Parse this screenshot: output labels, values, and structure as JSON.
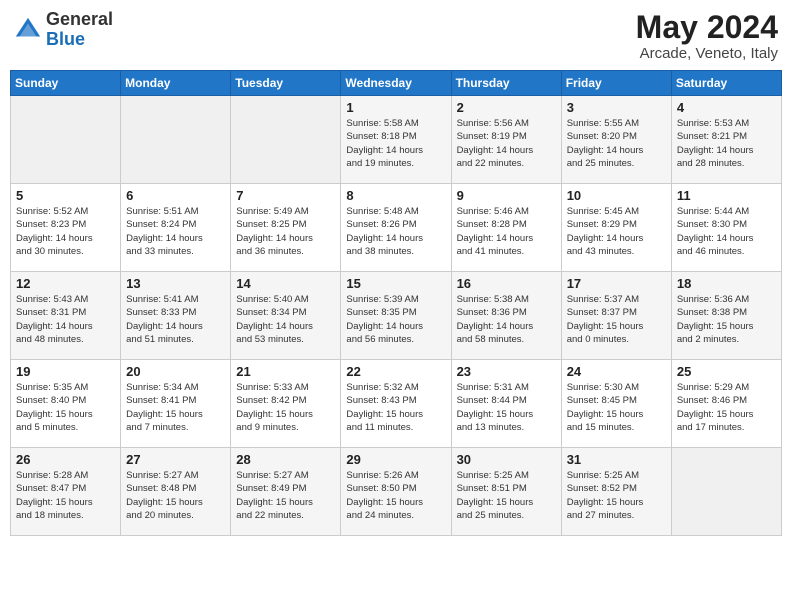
{
  "header": {
    "logo_general": "General",
    "logo_blue": "Blue",
    "month_title": "May 2024",
    "subtitle": "Arcade, Veneto, Italy"
  },
  "days_of_week": [
    "Sunday",
    "Monday",
    "Tuesday",
    "Wednesday",
    "Thursday",
    "Friday",
    "Saturday"
  ],
  "weeks": [
    [
      {
        "day": "",
        "info": ""
      },
      {
        "day": "",
        "info": ""
      },
      {
        "day": "",
        "info": ""
      },
      {
        "day": "1",
        "info": "Sunrise: 5:58 AM\nSunset: 8:18 PM\nDaylight: 14 hours\nand 19 minutes."
      },
      {
        "day": "2",
        "info": "Sunrise: 5:56 AM\nSunset: 8:19 PM\nDaylight: 14 hours\nand 22 minutes."
      },
      {
        "day": "3",
        "info": "Sunrise: 5:55 AM\nSunset: 8:20 PM\nDaylight: 14 hours\nand 25 minutes."
      },
      {
        "day": "4",
        "info": "Sunrise: 5:53 AM\nSunset: 8:21 PM\nDaylight: 14 hours\nand 28 minutes."
      }
    ],
    [
      {
        "day": "5",
        "info": "Sunrise: 5:52 AM\nSunset: 8:23 PM\nDaylight: 14 hours\nand 30 minutes."
      },
      {
        "day": "6",
        "info": "Sunrise: 5:51 AM\nSunset: 8:24 PM\nDaylight: 14 hours\nand 33 minutes."
      },
      {
        "day": "7",
        "info": "Sunrise: 5:49 AM\nSunset: 8:25 PM\nDaylight: 14 hours\nand 36 minutes."
      },
      {
        "day": "8",
        "info": "Sunrise: 5:48 AM\nSunset: 8:26 PM\nDaylight: 14 hours\nand 38 minutes."
      },
      {
        "day": "9",
        "info": "Sunrise: 5:46 AM\nSunset: 8:28 PM\nDaylight: 14 hours\nand 41 minutes."
      },
      {
        "day": "10",
        "info": "Sunrise: 5:45 AM\nSunset: 8:29 PM\nDaylight: 14 hours\nand 43 minutes."
      },
      {
        "day": "11",
        "info": "Sunrise: 5:44 AM\nSunset: 8:30 PM\nDaylight: 14 hours\nand 46 minutes."
      }
    ],
    [
      {
        "day": "12",
        "info": "Sunrise: 5:43 AM\nSunset: 8:31 PM\nDaylight: 14 hours\nand 48 minutes."
      },
      {
        "day": "13",
        "info": "Sunrise: 5:41 AM\nSunset: 8:33 PM\nDaylight: 14 hours\nand 51 minutes."
      },
      {
        "day": "14",
        "info": "Sunrise: 5:40 AM\nSunset: 8:34 PM\nDaylight: 14 hours\nand 53 minutes."
      },
      {
        "day": "15",
        "info": "Sunrise: 5:39 AM\nSunset: 8:35 PM\nDaylight: 14 hours\nand 56 minutes."
      },
      {
        "day": "16",
        "info": "Sunrise: 5:38 AM\nSunset: 8:36 PM\nDaylight: 14 hours\nand 58 minutes."
      },
      {
        "day": "17",
        "info": "Sunrise: 5:37 AM\nSunset: 8:37 PM\nDaylight: 15 hours\nand 0 minutes."
      },
      {
        "day": "18",
        "info": "Sunrise: 5:36 AM\nSunset: 8:38 PM\nDaylight: 15 hours\nand 2 minutes."
      }
    ],
    [
      {
        "day": "19",
        "info": "Sunrise: 5:35 AM\nSunset: 8:40 PM\nDaylight: 15 hours\nand 5 minutes."
      },
      {
        "day": "20",
        "info": "Sunrise: 5:34 AM\nSunset: 8:41 PM\nDaylight: 15 hours\nand 7 minutes."
      },
      {
        "day": "21",
        "info": "Sunrise: 5:33 AM\nSunset: 8:42 PM\nDaylight: 15 hours\nand 9 minutes."
      },
      {
        "day": "22",
        "info": "Sunrise: 5:32 AM\nSunset: 8:43 PM\nDaylight: 15 hours\nand 11 minutes."
      },
      {
        "day": "23",
        "info": "Sunrise: 5:31 AM\nSunset: 8:44 PM\nDaylight: 15 hours\nand 13 minutes."
      },
      {
        "day": "24",
        "info": "Sunrise: 5:30 AM\nSunset: 8:45 PM\nDaylight: 15 hours\nand 15 minutes."
      },
      {
        "day": "25",
        "info": "Sunrise: 5:29 AM\nSunset: 8:46 PM\nDaylight: 15 hours\nand 17 minutes."
      }
    ],
    [
      {
        "day": "26",
        "info": "Sunrise: 5:28 AM\nSunset: 8:47 PM\nDaylight: 15 hours\nand 18 minutes."
      },
      {
        "day": "27",
        "info": "Sunrise: 5:27 AM\nSunset: 8:48 PM\nDaylight: 15 hours\nand 20 minutes."
      },
      {
        "day": "28",
        "info": "Sunrise: 5:27 AM\nSunset: 8:49 PM\nDaylight: 15 hours\nand 22 minutes."
      },
      {
        "day": "29",
        "info": "Sunrise: 5:26 AM\nSunset: 8:50 PM\nDaylight: 15 hours\nand 24 minutes."
      },
      {
        "day": "30",
        "info": "Sunrise: 5:25 AM\nSunset: 8:51 PM\nDaylight: 15 hours\nand 25 minutes."
      },
      {
        "day": "31",
        "info": "Sunrise: 5:25 AM\nSunset: 8:52 PM\nDaylight: 15 hours\nand 27 minutes."
      },
      {
        "day": "",
        "info": ""
      }
    ]
  ]
}
